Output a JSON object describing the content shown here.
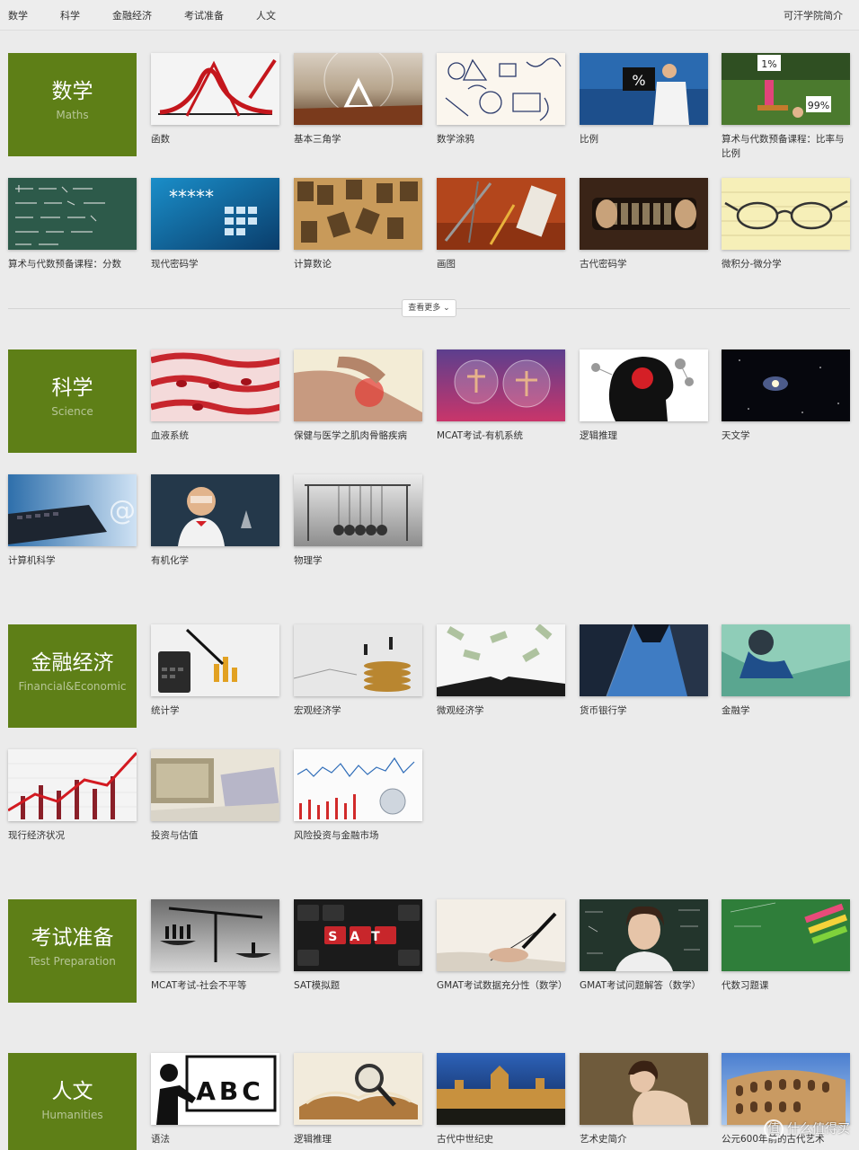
{
  "nav": {
    "items": [
      "数学",
      "科学",
      "金融经济",
      "考试准备",
      "人文"
    ],
    "about": "可汗学院简介"
  },
  "more_button": "查看更多",
  "sections": [
    {
      "title": "数学",
      "subtitle": "Maths",
      "courses": [
        "函数",
        "基本三角学",
        "数学涂鸦",
        "比例",
        "算术与代数预备课程：比率与比例",
        "算术与代数预备课程：分数",
        "现代密码学",
        "计算数论",
        "画图",
        "古代密码学",
        "微积分-微分学"
      ]
    },
    {
      "title": "科学",
      "subtitle": "Science",
      "courses": [
        "血液系统",
        "保健与医学之肌肉骨骼疾病",
        "MCAT考试-有机系统",
        "逻辑推理",
        "天文学",
        "计算机科学",
        "有机化学",
        "物理学"
      ]
    },
    {
      "title": "金融经济",
      "subtitle": "Financial&Economic",
      "courses": [
        "统计学",
        "宏观经济学",
        "微观经济学",
        "货币银行学",
        "金融学",
        "现行经济状况",
        "投资与估值",
        "风险投资与金融市场"
      ]
    },
    {
      "title": "考试准备",
      "subtitle": "Test Preparation",
      "courses": [
        "MCAT考试-社会不平等",
        "SAT模拟题",
        "GMAT考试数据充分性（数学）",
        "GMAT考试问题解答（数学）",
        "代数习题课"
      ]
    },
    {
      "title": "人文",
      "subtitle": "Humanities",
      "courses": [
        "语法",
        "逻辑推理",
        "古代中世纪史",
        "艺术史简介",
        "公元600年前的古代艺术"
      ]
    }
  ],
  "thumb_text": {
    "fraction": "%",
    "pct_top": "1%",
    "pct_bottom": "99%",
    "password": "*****",
    "sat": "SAT",
    "abc": "ABC",
    "at": "@"
  },
  "watermark": "什么值得买",
  "colors": {
    "tile_green": "#5e7f17",
    "background": "#ebebeb"
  }
}
